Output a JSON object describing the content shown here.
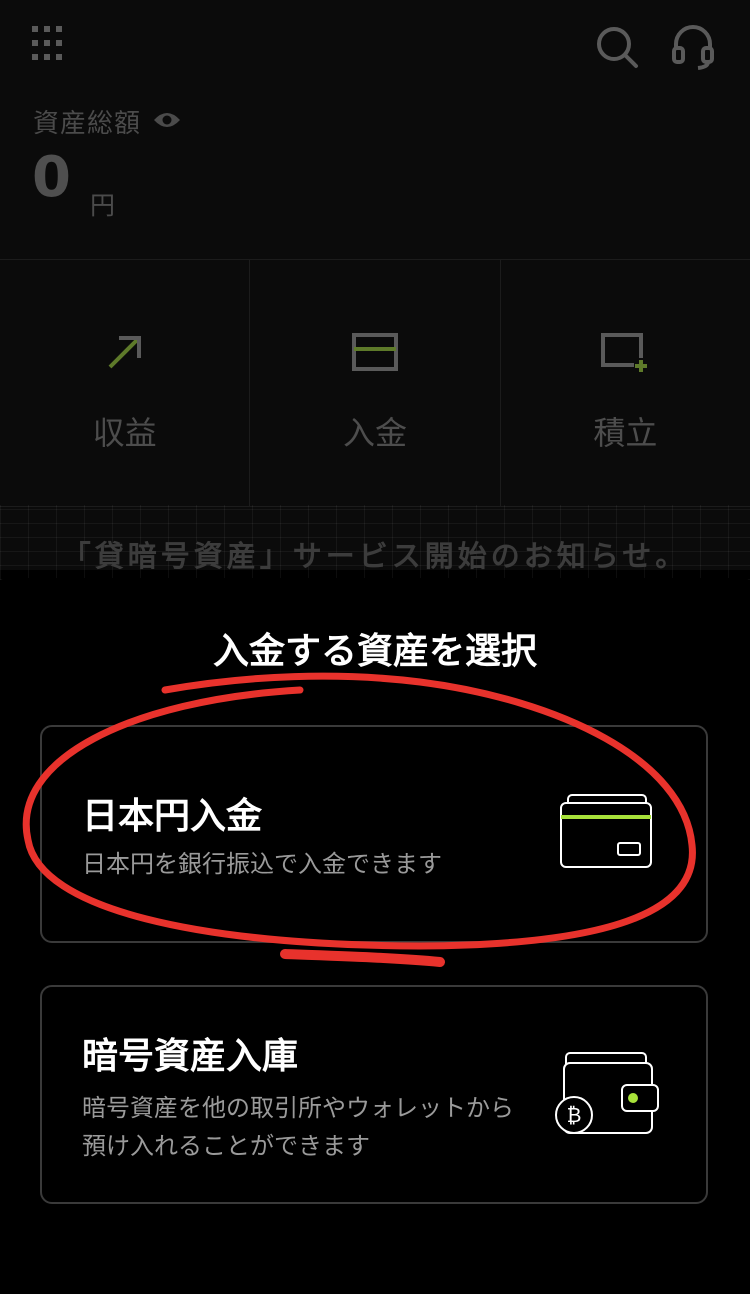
{
  "header": {
    "apps_icon": "grid-apps-icon",
    "search_icon": "search-icon",
    "support_icon": "headset-icon",
    "asset_label": "資産総額",
    "asset_value": "0",
    "asset_unit": "円",
    "eye_icon": "eye-icon"
  },
  "actions": [
    {
      "label": "収益",
      "icon": "arrow-up-right-icon"
    },
    {
      "label": "入金",
      "icon": "card-icon"
    },
    {
      "label": "積立",
      "icon": "square-plus-icon"
    }
  ],
  "notice": "「貸暗号資産」サービス開始のお知らせ。",
  "sheet": {
    "title": "入金する資産を選択",
    "options": [
      {
        "title": "日本円入金",
        "description": "日本円を銀行振込で入金できます",
        "icon": "card-icon"
      },
      {
        "title": "暗号資産入庫",
        "description": "暗号資産を他の取引所やウォレットから預け入れることができます",
        "icon": "bitcoin-wallet-icon"
      }
    ]
  },
  "colors": {
    "accent": "#a8e23a",
    "annotation": "#e8322c"
  }
}
